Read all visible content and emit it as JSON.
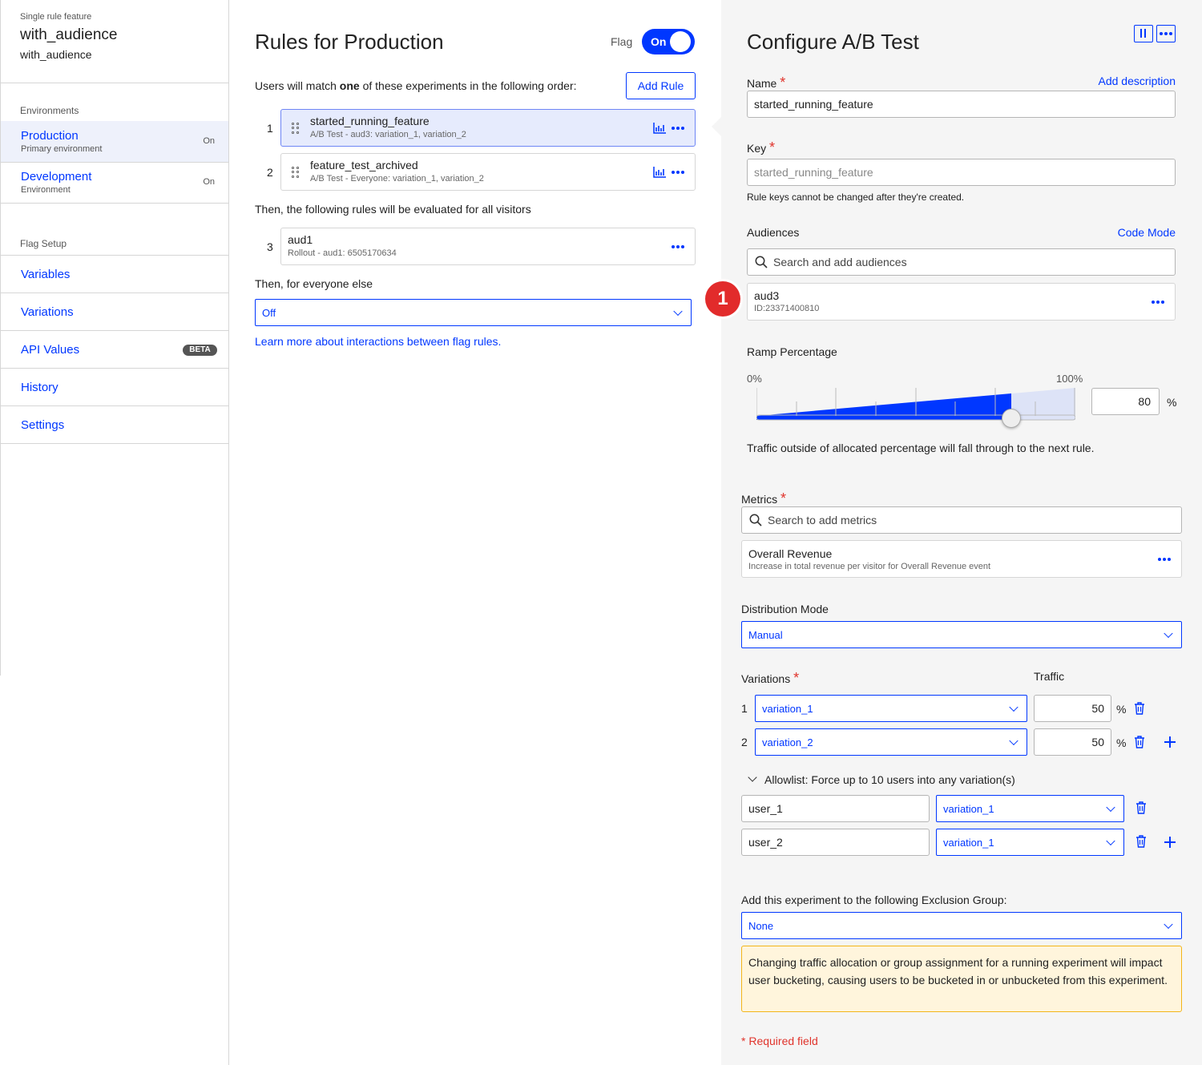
{
  "feature": {
    "type_label": "Single rule feature",
    "name": "with_audience",
    "key": "with_audience"
  },
  "sidebar": {
    "environments_heading": "Environments",
    "environments": [
      {
        "name": "Production",
        "subtitle": "Primary environment",
        "state": "On",
        "selected": true
      },
      {
        "name": "Development",
        "subtitle": "Environment",
        "state": "On",
        "selected": false
      }
    ],
    "flag_setup_heading": "Flag Setup",
    "nav": [
      {
        "label": "Variables"
      },
      {
        "label": "Variations"
      },
      {
        "label": "API Values",
        "badge": "BETA"
      },
      {
        "label": "History"
      },
      {
        "label": "Settings"
      }
    ]
  },
  "rules": {
    "title": "Rules for Production",
    "flag_label": "Flag",
    "flag_toggle": "On",
    "intro_prefix": "Users will match ",
    "intro_bold": "one",
    "intro_suffix": " of these experiments in the following order:",
    "add_rule_label": "Add Rule",
    "experiments": [
      {
        "index": "1",
        "title": "started_running_feature",
        "subtitle": "A/B Test - aud3: variation_1, variation_2"
      },
      {
        "index": "2",
        "title": "feature_test_archived",
        "subtitle": "A/B Test - Everyone: variation_1, variation_2"
      }
    ],
    "then_all_label": "Then, the following rules will be evaluated for all visitors",
    "rollouts": [
      {
        "index": "3",
        "title": "aud1",
        "subtitle": "Rollout - aud1: 6505170634"
      }
    ],
    "everyone_else_label": "Then, for everyone else",
    "everyone_else_value": "Off",
    "learn_more_link": "Learn more about interactions between flag rules."
  },
  "config": {
    "title": "Configure A/B Test",
    "name_label": "Name",
    "add_description_link": "Add description",
    "name_value": "started_running_feature",
    "key_label": "Key",
    "key_placeholder": "started_running_feature",
    "key_help": "Rule keys cannot be changed after they're created.",
    "audiences_label": "Audiences",
    "code_mode_link": "Code Mode",
    "audience_search_placeholder": "Search and add audiences",
    "audience": {
      "name": "aud3",
      "id": "ID:23371400810",
      "badge": "1"
    },
    "ramp_label": "Ramp Percentage",
    "ramp_min": "0%",
    "ramp_max": "100%",
    "ramp_value": "80",
    "ramp_fraction": 0.8,
    "ramp_unit": "%",
    "ramp_help": "Traffic outside of allocated percentage will fall through to the next rule.",
    "metrics_label": "Metrics",
    "metrics_search_placeholder": "Search to add metrics",
    "metric": {
      "name": "Overall Revenue",
      "description": "Increase in total revenue per visitor for Overall Revenue event"
    },
    "distribution_label": "Distribution Mode",
    "distribution_value": "Manual",
    "variations_label": "Variations",
    "traffic_label": "Traffic",
    "variations": [
      {
        "index": "1",
        "value": "variation_1",
        "traffic": "50",
        "unit": "%"
      },
      {
        "index": "2",
        "value": "variation_2",
        "traffic": "50",
        "unit": "%"
      }
    ],
    "allowlist_label": "Allowlist: Force up to 10 users into any variation(s)",
    "allowlist": [
      {
        "user": "user_1",
        "variation": "variation_1"
      },
      {
        "user": "user_2",
        "variation": "variation_1"
      }
    ],
    "exclusion_label": "Add this experiment to the following Exclusion Group:",
    "exclusion_value": "None",
    "warning_text": "Changing traffic allocation or group assignment for a running experiment will impact user bucketing, causing users to be bucketed in or unbucketed from this experiment.",
    "required_note": "* Required field"
  },
  "colors": {
    "accent": "#0037ff",
    "warning_bg": "#fff5dc",
    "warning_border": "#f3b519",
    "badge_red": "#e22b2b"
  }
}
